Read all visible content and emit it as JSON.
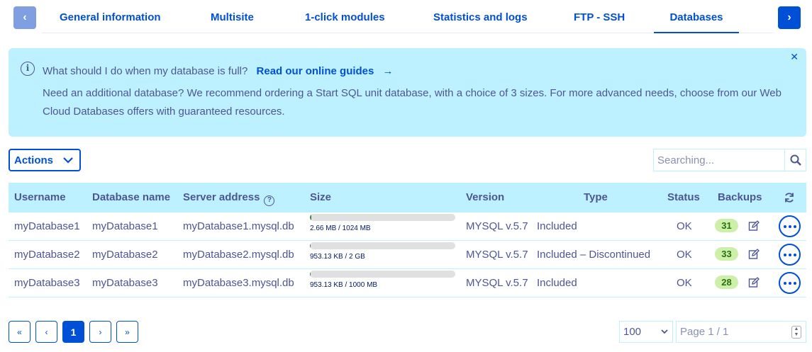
{
  "tabs": [
    {
      "label": "General information"
    },
    {
      "label": "Multisite"
    },
    {
      "label": "1-click modules"
    },
    {
      "label": "Statistics and logs"
    },
    {
      "label": "FTP - SSH"
    },
    {
      "label": "Databases",
      "active": true
    }
  ],
  "banner": {
    "question": "What should I do when my database is full?",
    "link": "Read our online guides",
    "body": "Need an additional database? We recommend ordering a Start SQL unit database, with a choice of 3 sizes. For more advanced needs, choose from our Web Cloud Databases offers with guaranteed resources.",
    "close_icon": "close-icon",
    "info_icon": "info-icon"
  },
  "toolbar": {
    "actions_label": "Actions",
    "search_placeholder": "Searching..."
  },
  "table": {
    "headers": {
      "username": "Username",
      "database_name": "Database name",
      "server_address": "Server address",
      "size": "Size",
      "version": "Version",
      "type": "Type",
      "status": "Status",
      "backups": "Backups"
    },
    "rows": [
      {
        "username": "myDatabase1",
        "database_name": "myDatabase1",
        "server_address": "myDatabase1.mysql.db",
        "size_text": "2.66 MB / 1024 MB",
        "usage_fraction": 0.0026,
        "version": "MYSQL v.5.7",
        "type": "Included",
        "status": "OK",
        "backups": "31"
      },
      {
        "username": "myDatabase2",
        "database_name": "myDatabase2",
        "server_address": "myDatabase2.mysql.db",
        "size_text": "953.13 KB / 2 GB",
        "usage_fraction": 0.0005,
        "version": "MYSQL v.5.7",
        "type": "Included – Discontinued",
        "status": "OK",
        "backups": "33"
      },
      {
        "username": "myDatabase3",
        "database_name": "myDatabase3",
        "server_address": "myDatabase3.mysql.db",
        "size_text": "953.13 KB / 1000 MB",
        "usage_fraction": 0.0009,
        "version": "MYSQL v.5.7",
        "type": "Included",
        "status": "OK",
        "backups": "28"
      }
    ]
  },
  "pagination": {
    "first": "«",
    "prev": "‹",
    "current": "1",
    "next": "›",
    "last": "»",
    "per_page": "100",
    "page_placeholder": "Page 1 / 1"
  },
  "colors": {
    "primary": "#0050d7",
    "banner_bg": "#bef1ff",
    "text": "#4d5693",
    "badge_bg": "#cdf0a9"
  }
}
